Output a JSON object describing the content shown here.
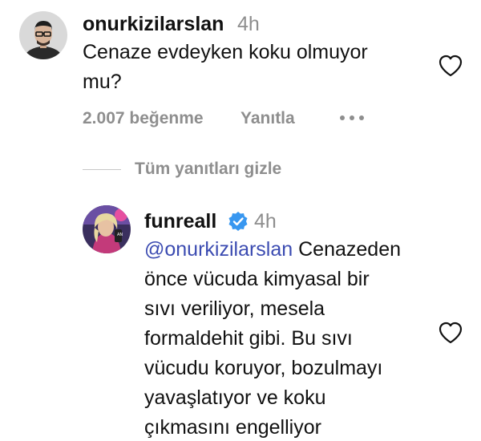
{
  "comment": {
    "username": "onurkizilarslan",
    "time": "4h",
    "text_line1": "Cenaze evdeyken koku olmuyor",
    "text_line2": "mu?",
    "likes": "2.007 beğenme",
    "reply_label": "Yanıtla"
  },
  "replies_toggle": "Tüm yanıtları gizle",
  "reply": {
    "username": "funreall",
    "time": "4h",
    "mention": "@onurkizilarslan",
    "lines": [
      "Cenazeden",
      "önce vücuda kimyasal bir",
      "sıvı veriliyor, mesela",
      "formaldehit gibi. Bu sıvı",
      "vücudu koruyor, bozulmayı",
      "yavaşlatıyor ve koku",
      "çıkmasını engelliyor"
    ]
  },
  "colors": {
    "mention": "#3b4bb1",
    "verified": "#3897f0",
    "secondary_text": "#8e8e8e"
  },
  "icons": {
    "like": "heart-outline-icon",
    "more": "more-horizontal-icon",
    "verified": "verified-badge-icon"
  }
}
